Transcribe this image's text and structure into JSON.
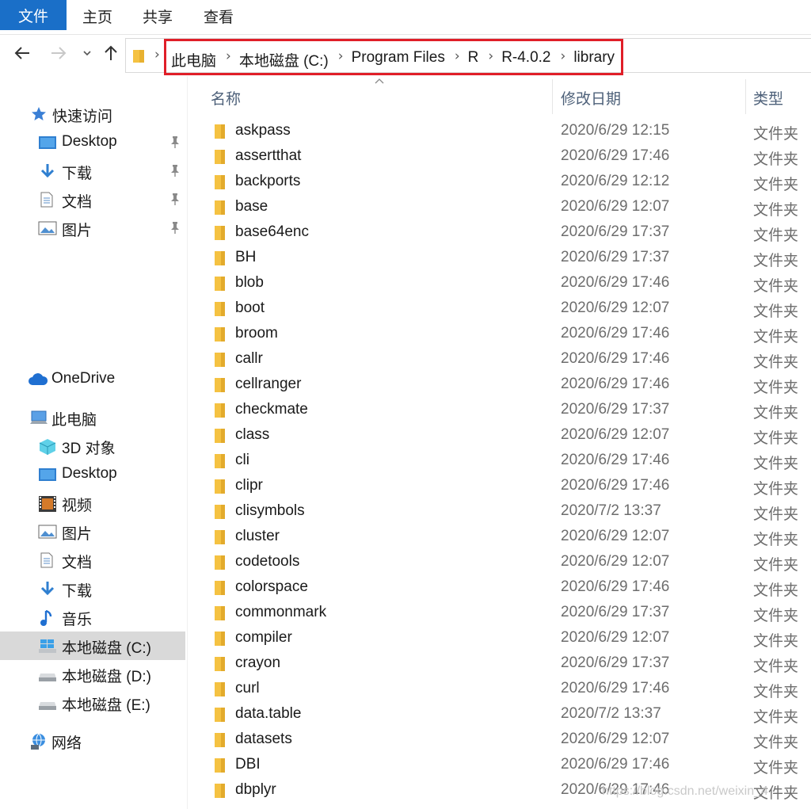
{
  "ribbon": {
    "tabs": [
      {
        "label": "文件",
        "active": true
      },
      {
        "label": "主页",
        "active": false
      },
      {
        "label": "共享",
        "active": false
      },
      {
        "label": "查看",
        "active": false
      }
    ]
  },
  "nav": {
    "back_icon": "arrow-left-icon",
    "forward_icon": "arrow-right-icon",
    "recent_icon": "chevron-down-icon",
    "up_icon": "arrow-up-icon"
  },
  "breadcrumb": [
    "此电脑",
    "本地磁盘 (C:)",
    "Program Files",
    "R",
    "R-4.0.2",
    "library"
  ],
  "sidebar": {
    "quick_access": {
      "label": "快速访问",
      "items": [
        {
          "label": "Desktop",
          "icon": "desktop-icon",
          "pinned": true
        },
        {
          "label": "下载",
          "icon": "download-icon",
          "pinned": true
        },
        {
          "label": "文档",
          "icon": "document-icon",
          "pinned": true
        },
        {
          "label": "图片",
          "icon": "picture-icon",
          "pinned": true
        }
      ]
    },
    "onedrive": {
      "label": "OneDrive",
      "icon": "cloud-icon"
    },
    "this_pc": {
      "label": "此电脑",
      "items": [
        {
          "label": "3D 对象",
          "icon": "cube-icon"
        },
        {
          "label": "Desktop",
          "icon": "desktop-icon"
        },
        {
          "label": "视频",
          "icon": "video-icon"
        },
        {
          "label": "图片",
          "icon": "picture-icon"
        },
        {
          "label": "文档",
          "icon": "document-icon"
        },
        {
          "label": "下载",
          "icon": "download-icon"
        },
        {
          "label": "音乐",
          "icon": "music-icon"
        },
        {
          "label": "本地磁盘 (C:)",
          "icon": "drive-icon",
          "selected": true
        },
        {
          "label": "本地磁盘 (D:)",
          "icon": "drive-icon"
        },
        {
          "label": "本地磁盘 (E:)",
          "icon": "drive-icon"
        }
      ]
    },
    "network": {
      "label": "网络",
      "icon": "network-icon"
    }
  },
  "columns": {
    "name": "名称",
    "modified": "修改日期",
    "type": "类型"
  },
  "files": [
    {
      "name": "askpass",
      "date": "2020/6/29 12:15",
      "type": "文件夹"
    },
    {
      "name": "assertthat",
      "date": "2020/6/29 17:46",
      "type": "文件夹"
    },
    {
      "name": "backports",
      "date": "2020/6/29 12:12",
      "type": "文件夹"
    },
    {
      "name": "base",
      "date": "2020/6/29 12:07",
      "type": "文件夹"
    },
    {
      "name": "base64enc",
      "date": "2020/6/29 17:37",
      "type": "文件夹"
    },
    {
      "name": "BH",
      "date": "2020/6/29 17:37",
      "type": "文件夹"
    },
    {
      "name": "blob",
      "date": "2020/6/29 17:46",
      "type": "文件夹"
    },
    {
      "name": "boot",
      "date": "2020/6/29 12:07",
      "type": "文件夹"
    },
    {
      "name": "broom",
      "date": "2020/6/29 17:46",
      "type": "文件夹"
    },
    {
      "name": "callr",
      "date": "2020/6/29 17:46",
      "type": "文件夹"
    },
    {
      "name": "cellranger",
      "date": "2020/6/29 17:46",
      "type": "文件夹"
    },
    {
      "name": "checkmate",
      "date": "2020/6/29 17:37",
      "type": "文件夹"
    },
    {
      "name": "class",
      "date": "2020/6/29 12:07",
      "type": "文件夹"
    },
    {
      "name": "cli",
      "date": "2020/6/29 17:46",
      "type": "文件夹"
    },
    {
      "name": "clipr",
      "date": "2020/6/29 17:46",
      "type": "文件夹"
    },
    {
      "name": "clisymbols",
      "date": "2020/7/2 13:37",
      "type": "文件夹"
    },
    {
      "name": "cluster",
      "date": "2020/6/29 12:07",
      "type": "文件夹"
    },
    {
      "name": "codetools",
      "date": "2020/6/29 12:07",
      "type": "文件夹"
    },
    {
      "name": "colorspace",
      "date": "2020/6/29 17:46",
      "type": "文件夹"
    },
    {
      "name": "commonmark",
      "date": "2020/6/29 17:37",
      "type": "文件夹"
    },
    {
      "name": "compiler",
      "date": "2020/6/29 12:07",
      "type": "文件夹"
    },
    {
      "name": "crayon",
      "date": "2020/6/29 17:37",
      "type": "文件夹"
    },
    {
      "name": "curl",
      "date": "2020/6/29 17:46",
      "type": "文件夹"
    },
    {
      "name": "data.table",
      "date": "2020/7/2 13:37",
      "type": "文件夹"
    },
    {
      "name": "datasets",
      "date": "2020/6/29 12:07",
      "type": "文件夹"
    },
    {
      "name": "DBI",
      "date": "2020/6/29 17:46",
      "type": "文件夹"
    },
    {
      "name": "dbplyr",
      "date": "2020/6/29 17:46",
      "type": "文件夹"
    }
  ],
  "colors": {
    "accent": "#1a6fc8",
    "highlight": "#e01e28",
    "folder": "#f5c242"
  },
  "watermark": "https://blog.csdn.net/weixin_4"
}
